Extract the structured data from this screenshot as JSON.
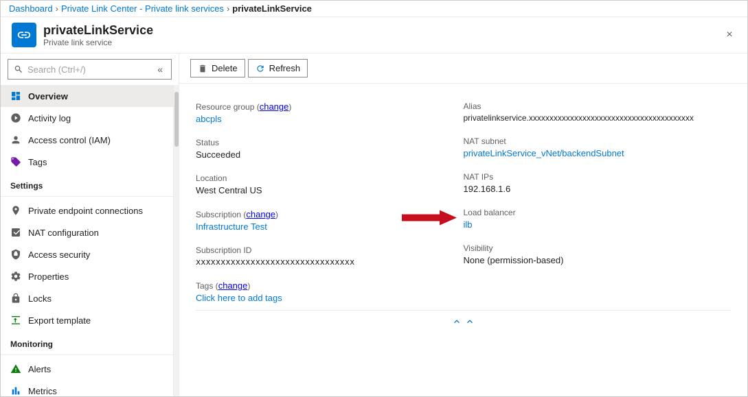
{
  "breadcrumb": {
    "items": [
      {
        "label": "Dashboard",
        "href": "#"
      },
      {
        "label": "Private Link Center - Private link services",
        "href": "#"
      },
      {
        "label": "privateLinkService",
        "href": null
      }
    ]
  },
  "header": {
    "title": "privateLinkService",
    "subtitle": "Private link service",
    "close_label": "×"
  },
  "toolbar": {
    "delete_label": "Delete",
    "refresh_label": "Refresh"
  },
  "sidebar": {
    "search_placeholder": "Search (Ctrl+/)",
    "nav_items": [
      {
        "id": "overview",
        "label": "Overview",
        "active": true
      },
      {
        "id": "activity-log",
        "label": "Activity log"
      },
      {
        "id": "access-control",
        "label": "Access control (IAM)"
      },
      {
        "id": "tags",
        "label": "Tags"
      }
    ],
    "sections": [
      {
        "label": "Settings",
        "items": [
          {
            "id": "private-endpoint",
            "label": "Private endpoint connections"
          },
          {
            "id": "nat-config",
            "label": "NAT configuration"
          },
          {
            "id": "access-security",
            "label": "Access security"
          },
          {
            "id": "properties",
            "label": "Properties"
          },
          {
            "id": "locks",
            "label": "Locks"
          },
          {
            "id": "export-template",
            "label": "Export template"
          }
        ]
      },
      {
        "label": "Monitoring",
        "items": [
          {
            "id": "alerts",
            "label": "Alerts"
          },
          {
            "id": "metrics",
            "label": "Metrics"
          }
        ]
      }
    ]
  },
  "details": {
    "left": [
      {
        "label": "Resource group",
        "value": "abcpls",
        "link": true,
        "change": true
      },
      {
        "label": "Status",
        "value": "Succeeded",
        "link": false
      },
      {
        "label": "Location",
        "value": "West Central US",
        "link": false
      },
      {
        "label": "Subscription",
        "value": "Infrastructure Test",
        "link": true,
        "change": true
      },
      {
        "label": "Subscription ID",
        "value": "xxxxxxxxxxxxxxxxxxxxxxxxxxxxxxxx",
        "link": false,
        "mono": true
      },
      {
        "label": "Tags",
        "change": true,
        "value": "Click here to add tags",
        "link": true
      }
    ],
    "right": [
      {
        "label": "Alias",
        "value": "privatelinkservice.xxxxxxxxxxxxxxxxxxxxxxxxxxxxxxxxxxxxxxxx",
        "link": false,
        "mono": false
      },
      {
        "label": "NAT subnet",
        "value": "privateLinkService_vNet/backendSubnet",
        "link": true
      },
      {
        "label": "NAT IPs",
        "value": "192.168.1.6",
        "link": false
      },
      {
        "label": "Load balancer",
        "value": "ilb",
        "link": true,
        "arrow": true
      },
      {
        "label": "Visibility",
        "value": "None (permission-based)",
        "link": false
      }
    ]
  }
}
